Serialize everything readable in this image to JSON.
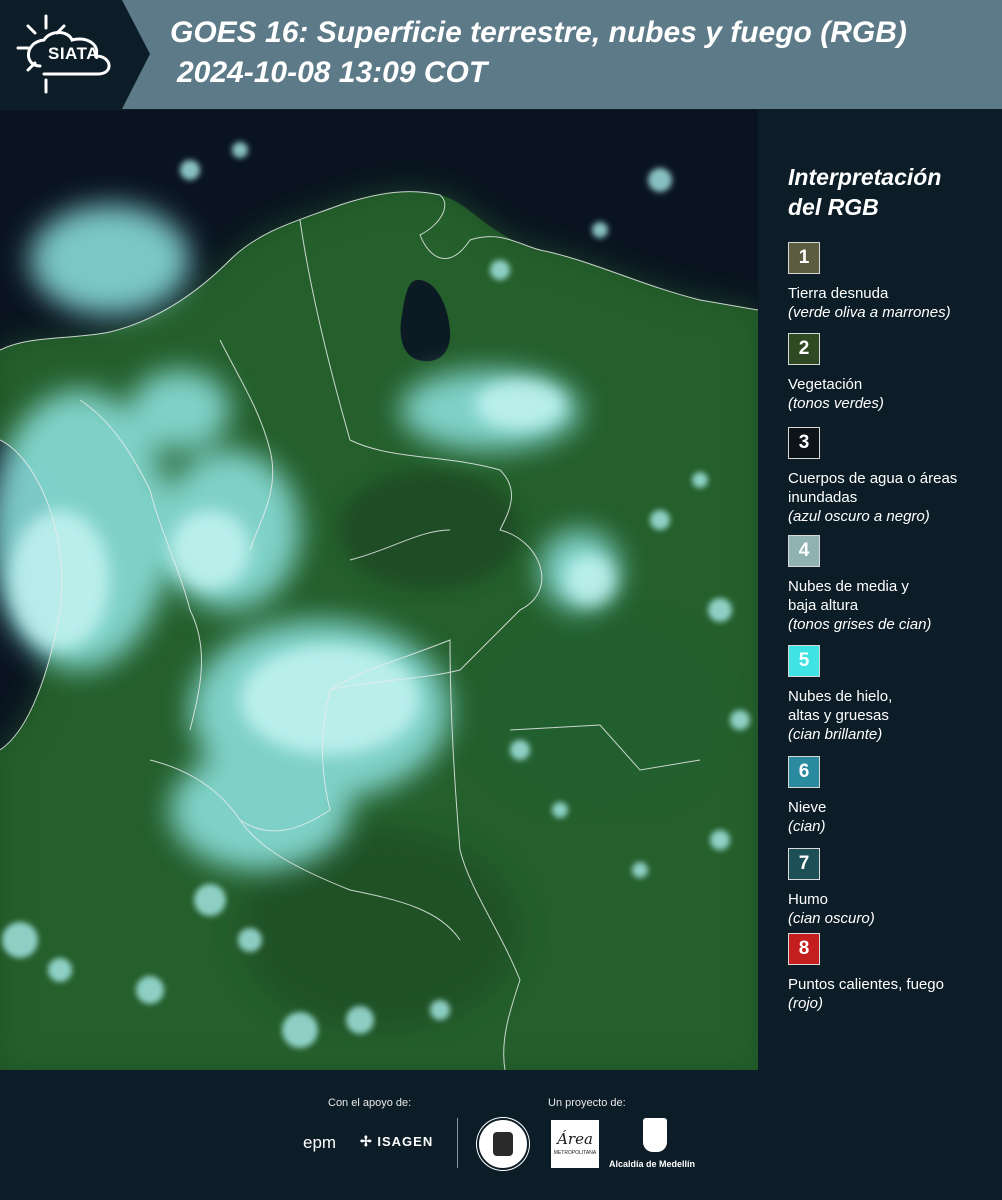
{
  "header": {
    "logo_text": "SIATA",
    "title": "GOES 16: Superficie terrestre, nubes y fuego (RGB)",
    "subtitle": "2024-10-08 13:09 COT"
  },
  "legend": {
    "title_line1": "Interpretación",
    "title_line2": "del RGB",
    "items": [
      {
        "num": "1",
        "color": "#5c5c40",
        "label": "Tierra desnuda",
        "note": "(verde oliva a marrones)"
      },
      {
        "num": "2",
        "color": "#2f4a22",
        "label": "Vegetación",
        "note": "(tonos verdes)"
      },
      {
        "num": "3",
        "color": "#0c1418",
        "label": "Cuerpos de agua o áreas inundadas",
        "note": "(azul oscuro a negro)"
      },
      {
        "num": "4",
        "color": "#8fb3b3",
        "label": "Nubes de media y baja altura",
        "note": "(tonos grises de cian)"
      },
      {
        "num": "5",
        "color": "#3fe3e3",
        "label": "Nubes de hielo, altas y gruesas",
        "note": "(cian brillante)"
      },
      {
        "num": "6",
        "color": "#2a8aa0",
        "label": "Nieve",
        "note": "(cian)"
      },
      {
        "num": "7",
        "color": "#1d4f56",
        "label": "Humo",
        "note": "(cian oscuro)"
      },
      {
        "num": "8",
        "color": "#c41e1e",
        "label": "Puntos calientes, fuego",
        "note": "(rojo)"
      }
    ]
  },
  "footer": {
    "support_caption": "Con el apoyo de:",
    "project_caption": "Un proyecto de:",
    "logo_epm": "epm",
    "logo_isagen": "ISAGEN",
    "logo_area": "Área",
    "logo_area_sub": "METROPOLITANA",
    "logo_alcaldia": "Alcaldía de Medellín"
  }
}
